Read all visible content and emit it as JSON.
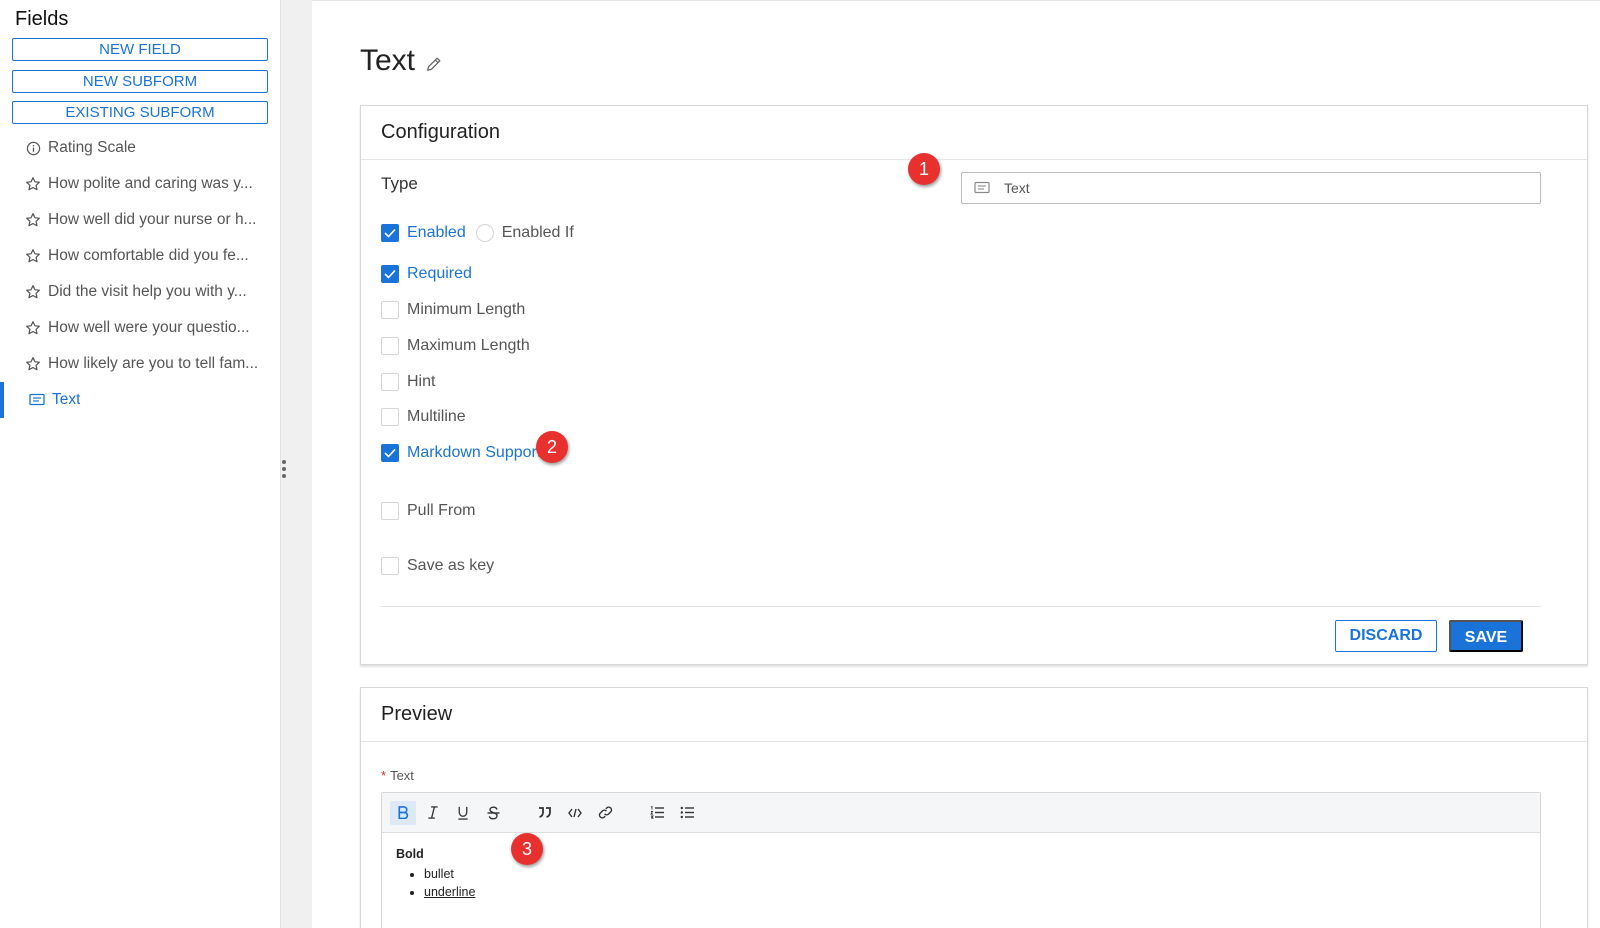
{
  "sidebar": {
    "title": "Fields",
    "buttons": {
      "new_field": "NEW FIELD",
      "new_subform": "NEW SUBFORM",
      "existing_subform": "EXISTING SUBFORM"
    },
    "items": [
      {
        "label": "Rating Scale",
        "icon": "info-circle-icon"
      },
      {
        "label": "How polite and caring was y...",
        "icon": "star-icon"
      },
      {
        "label": "How well did your nurse or h...",
        "icon": "star-icon"
      },
      {
        "label": "How comfortable did you fe...",
        "icon": "star-icon"
      },
      {
        "label": "Did the visit help you with y...",
        "icon": "star-icon"
      },
      {
        "label": "How well were your questio...",
        "icon": "star-icon"
      },
      {
        "label": "How likely are you to tell fam...",
        "icon": "star-icon"
      },
      {
        "label": "Text",
        "icon": "text-field-icon",
        "active": true
      }
    ]
  },
  "page": {
    "title": "Text"
  },
  "configuration": {
    "header": "Configuration",
    "type_label": "Type",
    "type_value": "Text",
    "options": {
      "enabled": "Enabled",
      "enabled_if": "Enabled If",
      "required": "Required",
      "minimum_length": "Minimum Length",
      "maximum_length": "Maximum Length",
      "hint": "Hint",
      "multiline": "Multiline",
      "markdown_support": "Markdown Support",
      "pull_from": "Pull From",
      "save_as_key": "Save as key"
    },
    "checked": {
      "enabled": true,
      "enabled_if": false,
      "required": true,
      "minimum_length": false,
      "maximum_length": false,
      "hint": false,
      "multiline": false,
      "markdown_support": true,
      "pull_from": false,
      "save_as_key": false
    },
    "discard_label": "DISCARD",
    "save_label": "SAVE"
  },
  "preview": {
    "header": "Preview",
    "required_mark": "*",
    "field_label": "Text",
    "content": {
      "bold": "Bold",
      "bullet": "bullet",
      "underline": "underline"
    }
  },
  "annotations": {
    "one": "1",
    "two": "2",
    "three": "3"
  },
  "colors": {
    "accent": "#1a73d9",
    "badge": "#e8312f"
  }
}
